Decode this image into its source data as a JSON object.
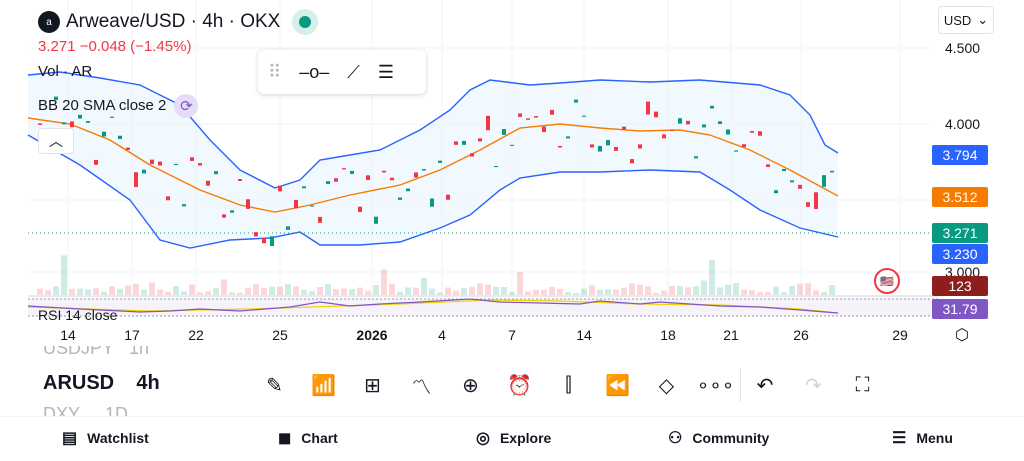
{
  "header": {
    "logo_text": "a",
    "symbol_title": "Arweave/USD · 4h · OKX",
    "change": "3.271  −0.048 (−1.45%)",
    "currency": "USD",
    "currency_caret": "⌄"
  },
  "indicators": {
    "volume": "Vol · AR",
    "bb": "BB 20 SMA close 2",
    "rsi": "RSI 14 close"
  },
  "price_axis": {
    "ticks": [
      "4.500",
      "4.000",
      "3.000"
    ],
    "labels": [
      {
        "value": "3.794",
        "color": "#2962ff"
      },
      {
        "value": "3.512",
        "color": "#f57c00"
      },
      {
        "value": "3.271",
        "color": "#089981"
      },
      {
        "value": "3.230",
        "color": "#2962ff"
      },
      {
        "value": "123",
        "color": "#8e1d1d"
      },
      {
        "value": "31.79",
        "color": "#7e57c2"
      }
    ]
  },
  "time_axis": [
    "14",
    "17",
    "22",
    "25",
    "2026",
    "4",
    "7",
    "14",
    "18",
    "21",
    "26",
    "29"
  ],
  "bottom": {
    "prev_symbol": "USDJPY",
    "prev_interval": "1h",
    "symbol": "ARUSD",
    "interval": "4h",
    "next_symbol": "DXY",
    "next_interval": "1D"
  },
  "toolbar": [
    "pencil-icon",
    "indicators-icon",
    "layouts-icon",
    "compare-icon",
    "add-icon",
    "alert-icon",
    "candles-icon",
    "replay-icon",
    "layers-icon",
    "more-icon",
    "undo-icon",
    "redo-icon",
    "fullscreen-icon"
  ],
  "nav": [
    {
      "label": "Watchlist",
      "icon": "▤"
    },
    {
      "label": "Chart",
      "icon": "◼"
    },
    {
      "label": "Explore",
      "icon": "◎"
    },
    {
      "label": "Community",
      "icon": "⚇"
    },
    {
      "label": "Menu",
      "icon": "☰"
    }
  ]
}
